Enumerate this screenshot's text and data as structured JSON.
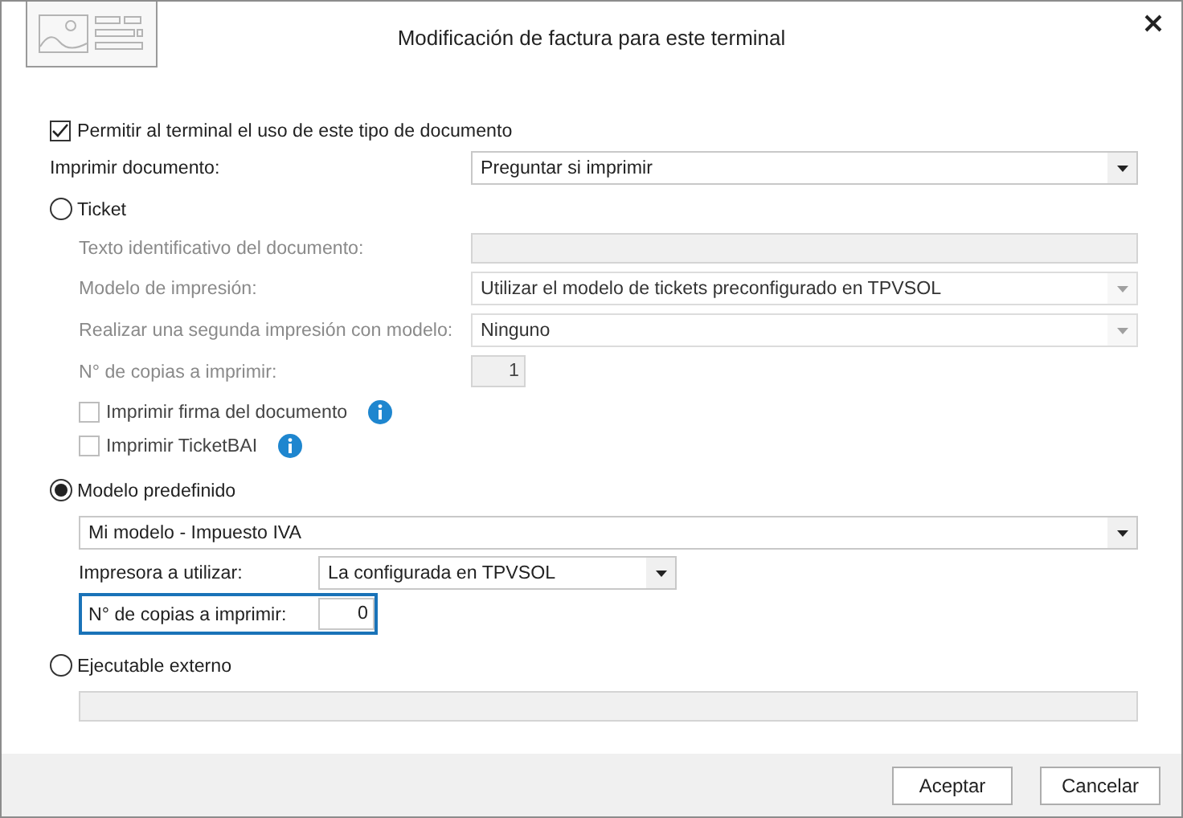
{
  "window": {
    "title": "Modificación de factura para este terminal"
  },
  "allow": {
    "label": "Permitir al terminal el uso de este tipo de documento",
    "checked": true
  },
  "print_document": {
    "label": "Imprimir documento:",
    "value": "Preguntar si imprimir"
  },
  "options": [
    {
      "kind": "ticket",
      "label": "Ticket",
      "selected": false,
      "fields": [
        {
          "kind": "text",
          "label": "Texto identificativo del documento:"
        },
        {
          "kind": "dropdown",
          "label": "Modelo de impresión:",
          "value": "Utilizar el modelo de tickets preconfigurado en TPVSOL"
        },
        {
          "kind": "dropdown",
          "label": "Realizar una segunda impresión con modelo:",
          "value": "Ninguno"
        },
        {
          "kind": "number",
          "label": "N° de copias a imprimir:",
          "value": "1",
          "focused": false
        },
        {
          "kind": "checkbox",
          "label": "Imprimir firma del documento",
          "checked": false,
          "info": true
        },
        {
          "kind": "checkbox",
          "label": "Imprimir TicketBAI",
          "checked": false,
          "info": true
        }
      ]
    },
    {
      "kind": "model",
      "label": "Modelo predefinido",
      "selected": true,
      "fields": [
        {
          "kind": "dropdown",
          "value": "Mi modelo - Impuesto IVA"
        },
        {
          "kind": "dropdown",
          "label": "Impresora a utilizar:",
          "value": "La configurada en TPVSOL"
        },
        {
          "kind": "number",
          "label": "N° de copias a imprimir:",
          "value": "0",
          "focused": true
        }
      ]
    },
    {
      "kind": "external",
      "label": "Ejecutable externo",
      "selected": false,
      "fields": [
        {
          "kind": "text"
        }
      ]
    }
  ],
  "buttons": [
    "Aceptar",
    "Cancelar"
  ]
}
